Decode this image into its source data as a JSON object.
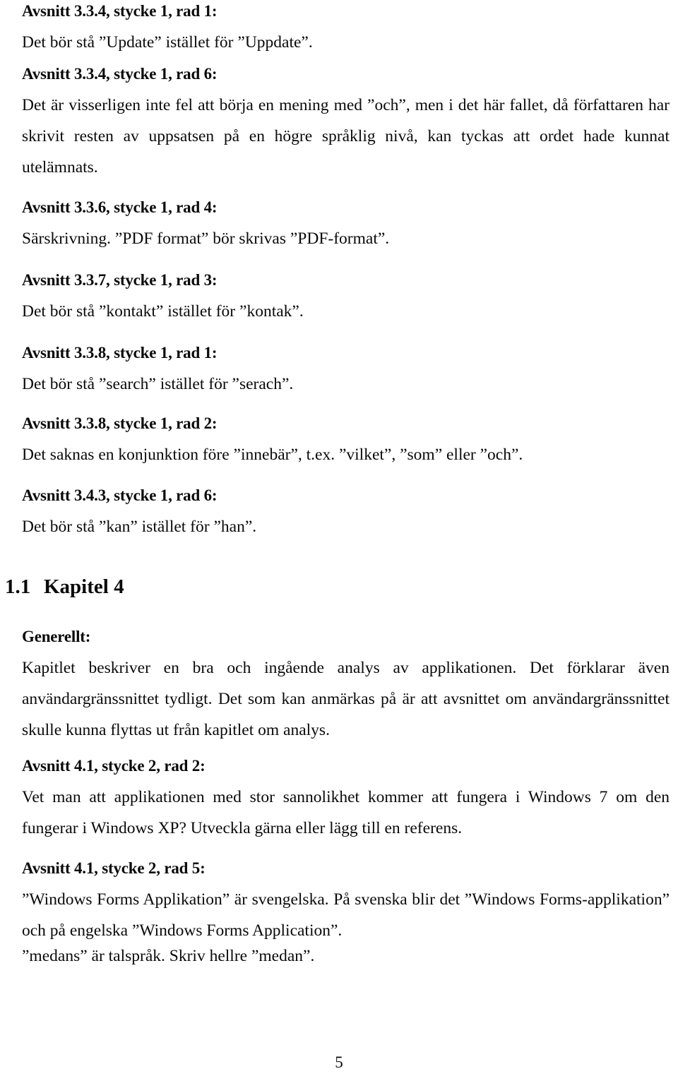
{
  "document": {
    "page_number": "5",
    "language": "sv"
  },
  "notes": [
    {
      "heading": "Avsnitt 3.3.4, stycke 1, rad 1:",
      "body": "Det bör stå ”Update” istället för ”Uppdate”."
    },
    {
      "heading": "Avsnitt 3.3.4, stycke 1, rad 6:",
      "body": "Det är visserligen inte fel att börja en mening med ”och”, men i det här fallet, då författaren har skrivit resten av uppsatsen på en högre språklig nivå, kan tyckas att ordet hade kunnat utelämnats."
    },
    {
      "heading": "Avsnitt 3.3.6, stycke 1, rad 4:",
      "body": "Särskrivning. ”PDF format” bör skrivas ”PDF-format”."
    },
    {
      "heading": "Avsnitt 3.3.7, stycke 1, rad 3:",
      "body": "Det bör stå ”kontakt” istället för ”kontak”."
    },
    {
      "heading": "Avsnitt 3.3.8, stycke 1, rad 1:",
      "body": "Det bör stå ”search” istället för ”serach”."
    },
    {
      "heading": "Avsnitt 3.3.8, stycke 1, rad 2:",
      "body": "Det saknas en konjunktion före ”innebär”, t.ex. ”vilket”, ”som” eller ”och”."
    },
    {
      "heading": "Avsnitt 3.4.3, stycke 1, rad 6:",
      "body": "Det bör stå ”kan” istället för ”han”."
    }
  ],
  "section": {
    "number": "1.1",
    "title": "Kapitel 4",
    "general_label": "Generellt:",
    "general_body": "Kapitlet beskriver en bra och ingående analys av applikationen. Det förklarar även användargränssnittet tydligt. Det som kan anmärkas på är att avsnittet om användargränssnittet skulle kunna flyttas ut från kapitlet om analys."
  },
  "section_notes": [
    {
      "heading": "Avsnitt 4.1, stycke 2, rad 2:",
      "body": "Vet man att applikationen med stor sannolikhet kommer att fungera i Windows 7 om den fungerar i Windows XP? Utveckla gärna eller lägg till en referens."
    },
    {
      "heading": "Avsnitt 4.1, stycke 2, rad 5:",
      "body": "”Windows Forms Applikation” är svengelska. På svenska blir det ”Windows Forms-applikation” och på engelska ”Windows Forms Application”."
    }
  ],
  "closing_note": "”medans” är talspråk. Skriv hellre ”medan”."
}
